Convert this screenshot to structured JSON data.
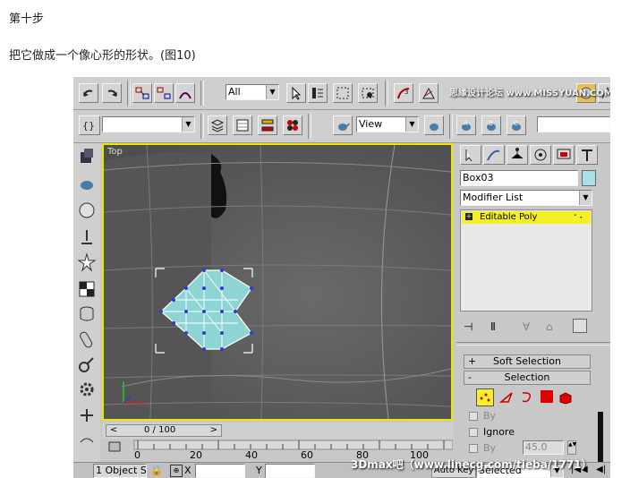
{
  "article": {
    "step_title": "第十步",
    "step_desc": "把它做成一个像心形的形状。(图10)"
  },
  "watermark_top": "思缘设计论坛 www.MISSYUAN.COM",
  "toolbar": {
    "filter_value": "All",
    "refcoord_value": "View",
    "named_selection": ""
  },
  "viewport": {
    "label": "Top"
  },
  "panel": {
    "object_name": "Box03",
    "modifier_list": "Modifier List",
    "stack_item": "Editable Poly",
    "rollout_soft_sign": "+",
    "rollout_soft": "Soft Selection",
    "rollout_sel_sign": "-",
    "rollout_sel": "Selection",
    "by_label_1": "By",
    "ignore_label": "Ignore",
    "by_label_2": "By",
    "angle_value": "45.0"
  },
  "timeline": {
    "frame_counter": "0 / 100",
    "prev_label": "<",
    "next_label": ">",
    "ticks": [
      "0",
      "20",
      "40",
      "60",
      "80",
      "100"
    ]
  },
  "statusbar": {
    "selection_info": "1 Object Se",
    "x_label": "X",
    "y_label": "Y",
    "autokey": "Auto Key",
    "selected": "Selected"
  },
  "watermark_bottom": "3Dmax吧（www.linecg.com/tieba/1771）",
  "colors": {
    "viewport_border": "#f0e400",
    "shape_fill": "#8fd4d4",
    "stack_highlight": "#f5ee2a",
    "vertex": "#2d3bd6"
  }
}
